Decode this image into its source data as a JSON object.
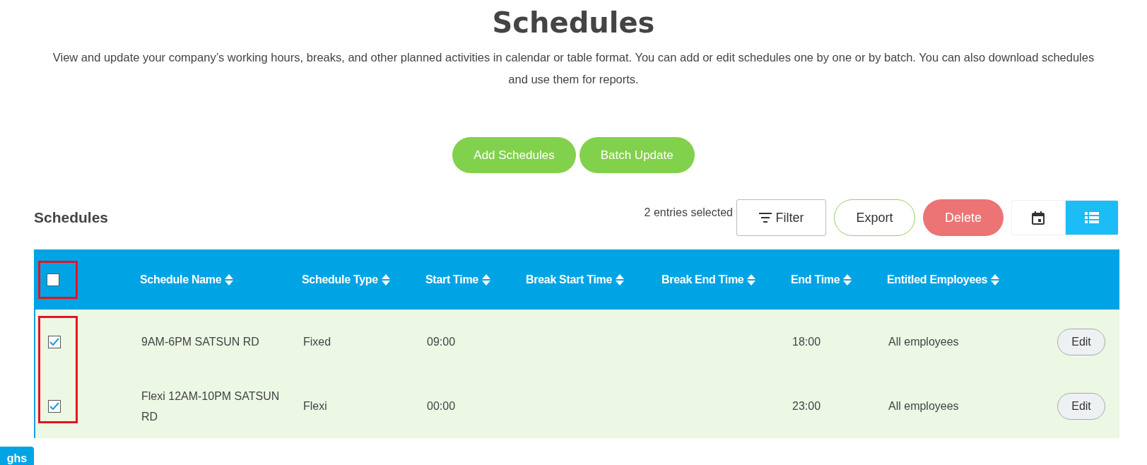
{
  "page": {
    "title": "Schedules",
    "description": "View and update your company’s working hours, breaks, and other planned activities in calendar or table format. You can add or edit schedules one by one or by batch. You can also download schedules and use them for reports."
  },
  "actions": [
    "Add Schedules",
    "Batch Update"
  ],
  "toolbar": {
    "heading": "Schedules",
    "selection_count": "2 entries selected",
    "filter": "Filter",
    "export": "Export",
    "delete": "Delete",
    "views": [
      {
        "kind": "calendar",
        "selected": false
      },
      {
        "kind": "list",
        "selected": true
      }
    ]
  },
  "table": {
    "select_all": {
      "checked": false,
      "outlined": true
    },
    "row_checkboxes_outlined": true,
    "columns": [
      "Schedule Name",
      "Schedule Type",
      "Start Time",
      "Break Start Time",
      "Break End Time",
      "End Time",
      "Entitled Employees"
    ],
    "rows": [
      {
        "checked": true,
        "cells": [
          "9AM-6PM SATSUN RD",
          "Fixed",
          "09:00",
          "",
          "",
          "18:00",
          "All employees"
        ],
        "action": "Edit"
      },
      {
        "checked": true,
        "cells": [
          "Flexi 12AM-10PM SATSUN RD",
          "Flexi",
          "00:00",
          "",
          "",
          "23:00",
          "All employees"
        ],
        "action": "Edit"
      }
    ]
  },
  "side_tab": "ghs"
}
